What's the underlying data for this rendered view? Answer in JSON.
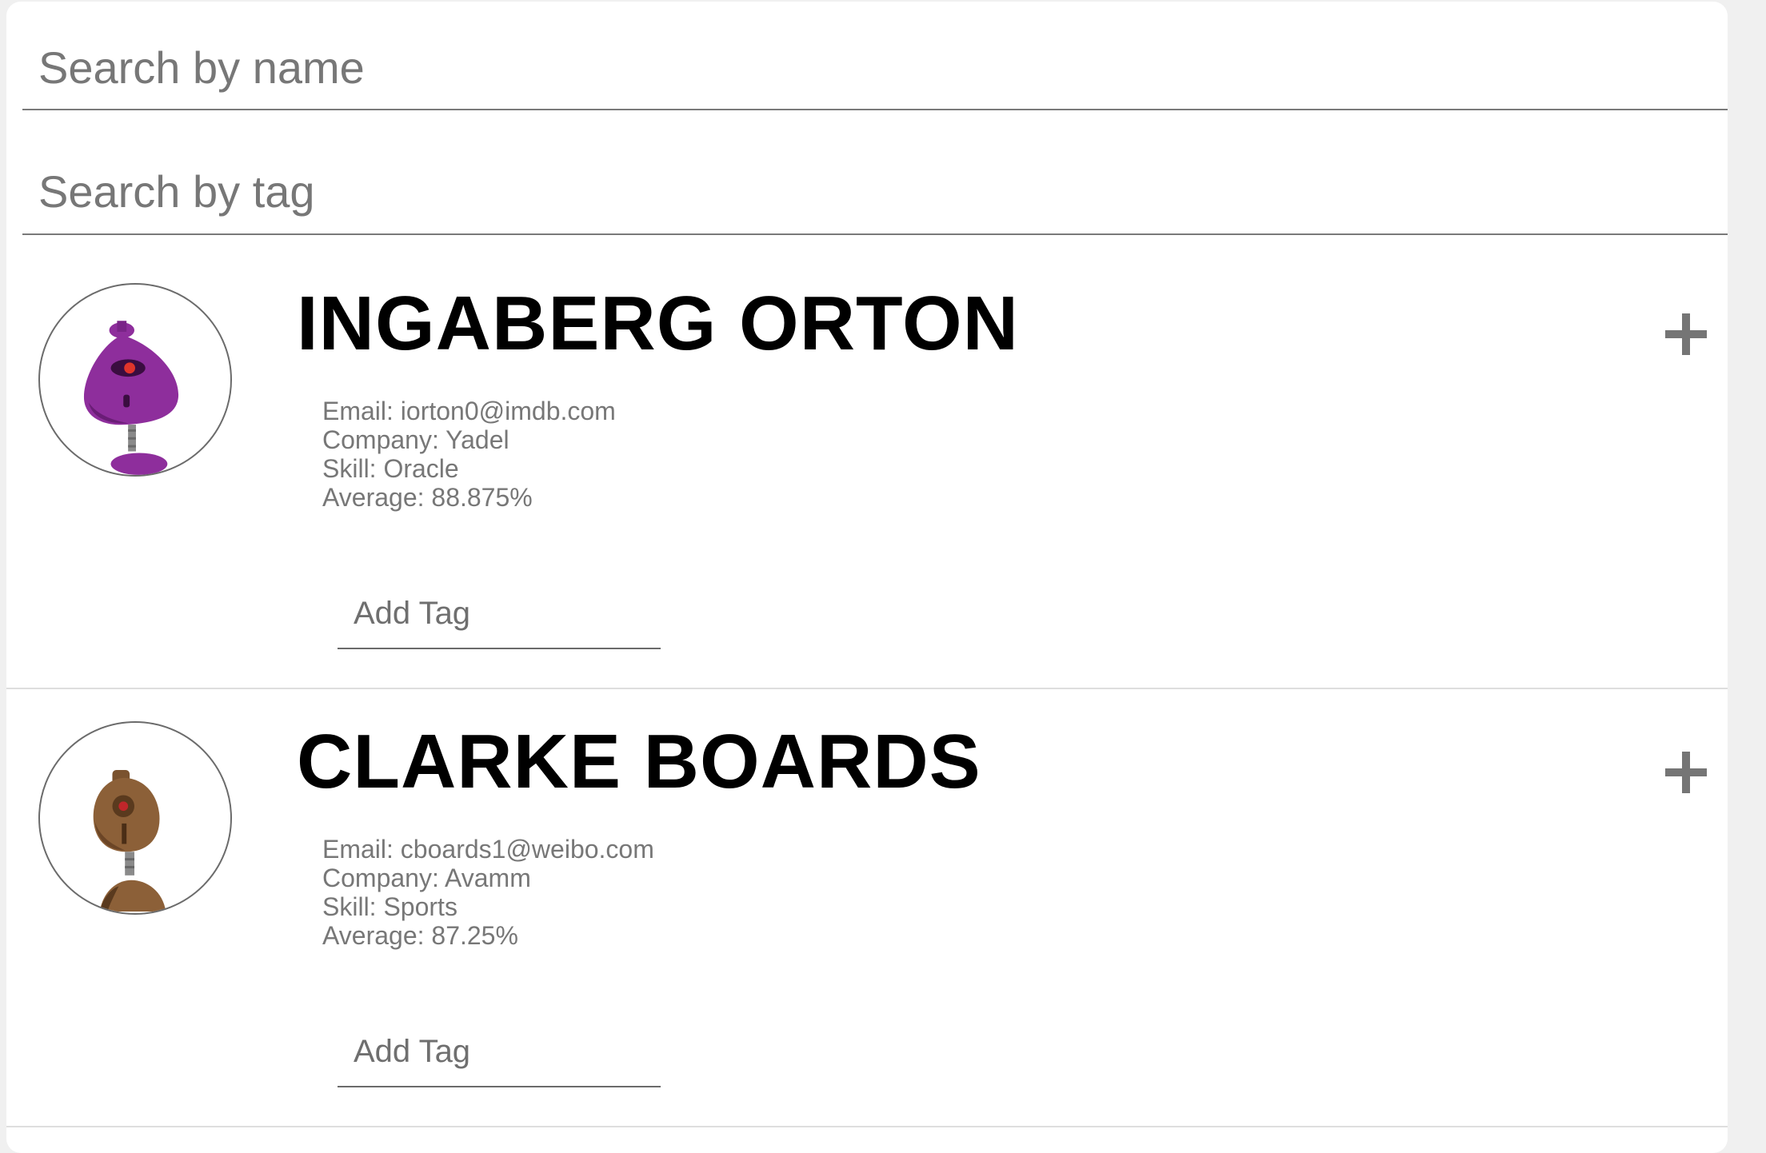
{
  "search": {
    "name_placeholder": "Search by name",
    "tag_placeholder": "Search by tag"
  },
  "students": [
    {
      "name": "INGABERG ORTON",
      "email": "Email: iorton0@imdb.com",
      "company": "Company: Yadel",
      "skill": "Skill: Oracle",
      "average": "Average: 88.875%",
      "avatar_icon": "purple-robot-avatar",
      "avatar_color": "#8e2e9c",
      "tag_placeholder": "Add Tag"
    },
    {
      "name": "CLARKE BOARDS",
      "email": "Email: cboards1@weibo.com",
      "company": "Company: Avamm",
      "skill": "Skill: Sports",
      "average": "Average: 87.25%",
      "avatar_icon": "brown-robot-avatar",
      "avatar_color": "#8c6038",
      "tag_placeholder": "Add Tag"
    }
  ],
  "icons": {
    "expand": "plus-icon"
  },
  "colors": {
    "page_background": "#f0f0f0",
    "card_background": "#ffffff",
    "name_text": "#000000",
    "detail_text": "#777777",
    "plus_icon": "#757575"
  }
}
